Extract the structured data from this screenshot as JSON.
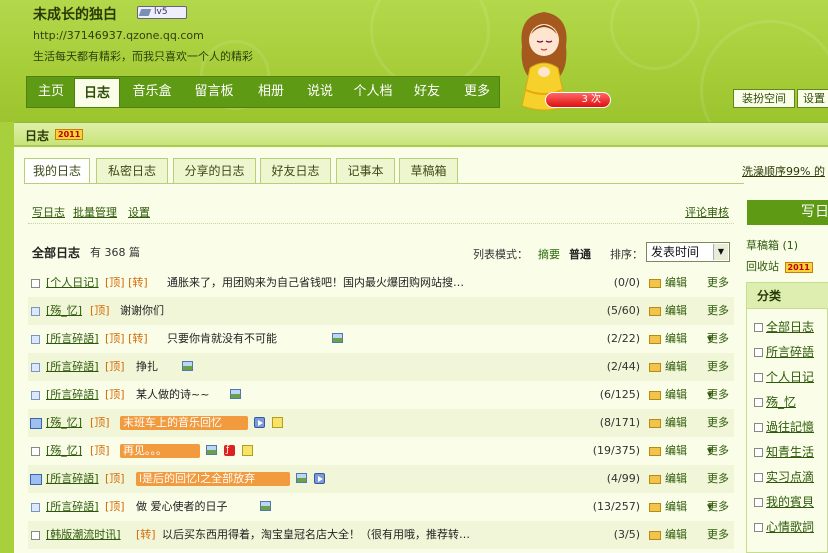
{
  "header": {
    "title": "未成长的独白",
    "level": "lv5",
    "url": "http://37146937.qzone.qq.com",
    "motto": "生活每天都有精彩，而我只喜欢一个人的精彩",
    "visit_count": "3 次",
    "dress_button": "装扮空间",
    "settings_button": "设置"
  },
  "nav": [
    "主页",
    "日志",
    "音乐盒",
    "留言板",
    "相册",
    "说说",
    "个人档",
    "好友",
    "更多"
  ],
  "section": {
    "title": "日志",
    "badge": "2011"
  },
  "tabs": [
    "我的日志",
    "私密日志",
    "分享的日志",
    "好友日志",
    "记事本",
    "草稿箱"
  ],
  "sort_note": "洗澡顺序99% 的",
  "actions": {
    "write": "写日志",
    "batch": "批量管理",
    "settings": "设置",
    "review": "评论审核"
  },
  "list_header": {
    "title": "全部日志",
    "count": "有 368 篇",
    "mode_label": "列表模式：",
    "mode_summary": "摘要",
    "mode_normal": "普通",
    "sort_label": "排序：",
    "sort_value": "发表时间"
  },
  "row_labels": {
    "edit": "编辑",
    "more": "更多▾"
  },
  "posts": [
    {
      "cat": "[个人日记]",
      "tags": "[顶]  [转]",
      "title": "通胀来了，用团购来为自己省钱吧！国内最火爆团购网站搜…",
      "stats": "(0/0)"
    },
    {
      "cat": "[殇_忆]",
      "tags": "[顶]",
      "title": "谢谢你们",
      "stats": "(5/60)"
    },
    {
      "cat": "[所言碎語]",
      "tags": "[顶]  [转]",
      "title": "只要你肯就没有不可能",
      "stats": "(2/22)"
    },
    {
      "cat": "[所言碎語]",
      "tags": "[顶]",
      "title": "挣扎",
      "stats": "(2/44)"
    },
    {
      "cat": "[所言碎語]",
      "tags": "[顶]",
      "title": "某人做的诗~~",
      "stats": "(6/125)"
    },
    {
      "cat": "[殇_忆]",
      "tags": "[顶]",
      "title": "末班车上的音乐回忆",
      "stats": "(8/171)"
    },
    {
      "cat": "[殇_忆]",
      "tags": "[顶]",
      "title": "再见。。。",
      "stats": "(19/375)"
    },
    {
      "cat": "[所言碎語]",
      "tags": "[顶]",
      "title": "l是后的回忆l之全部放弃",
      "stats": "(4/99)"
    },
    {
      "cat": "[所言碎語]",
      "tags": "[顶]",
      "title": "做  爱心使者的日子",
      "stats": "(13/257)"
    },
    {
      "cat": "[韩版潮流时讯]",
      "tags": "[转]",
      "title": "以后买东西用得着，淘宝皇冠名店大全！（很有用哦，推荐转…",
      "stats": "(3/5)"
    }
  ],
  "sidebar": {
    "write_button": "写日志",
    "draft": "草稿箱 (1)",
    "recycle": "回收站",
    "recycle_badge": "2011",
    "category_title": "分类",
    "categories": [
      "全部日志",
      "所言碎語",
      "个人日记",
      "殇_忆",
      "過往記憶",
      "知青生活",
      "实习点滴",
      "我的賓貝",
      "心情歌詞"
    ]
  },
  "colors": {
    "page_bg": "#a8cf3c",
    "nav_bg": "#5e9a14",
    "panel_bg": "#fafde8",
    "link": "#2d5a0a",
    "tag": "#d46b08"
  }
}
